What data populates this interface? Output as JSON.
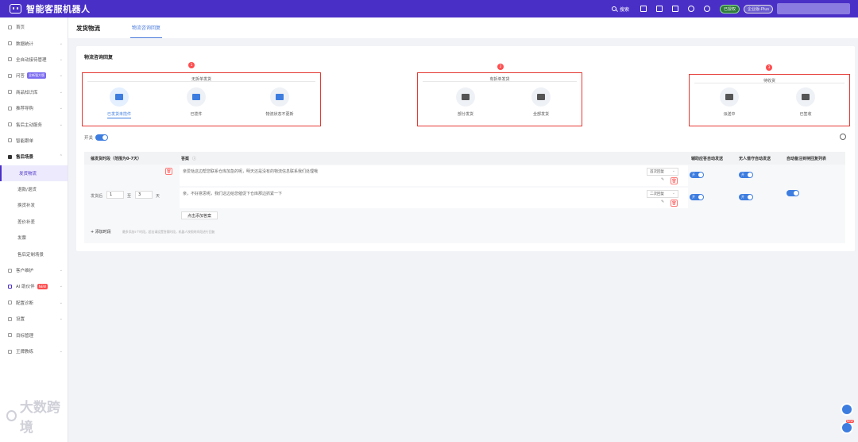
{
  "app": {
    "title": "智能客服机器人"
  },
  "topbar": {
    "search_label": "搜索",
    "badge_authorized": "已授权",
    "badge_plan": "企业版-Plus"
  },
  "sidebar": {
    "items": [
      {
        "label": "首页"
      },
      {
        "label": "数据统计"
      },
      {
        "label": "全自动接待管理"
      },
      {
        "label": "问答",
        "badge": "全新强大版"
      },
      {
        "label": "商品知识库"
      },
      {
        "label": "推荐导购"
      },
      {
        "label": "售后主动服务"
      },
      {
        "label": "智能跟单"
      },
      {
        "label": "售后场景"
      },
      {
        "label": "发货物流"
      },
      {
        "label": "退款/退货"
      },
      {
        "label": "换货补发"
      },
      {
        "label": "差价补差"
      },
      {
        "label": "发票"
      },
      {
        "label": "售后定制场景"
      },
      {
        "label": "客户维护"
      },
      {
        "label": "AI 助伙伴",
        "badge": "NEW"
      },
      {
        "label": "配置诊断"
      },
      {
        "label": "设置"
      },
      {
        "label": "目标管理"
      },
      {
        "label": "王牌教练"
      }
    ]
  },
  "watermark": "大数跨境",
  "tabs": {
    "page_title": "发货物流",
    "active_tab": "物流咨询回复"
  },
  "card": {
    "title": "物流咨询回复",
    "groups": [
      {
        "number": "1",
        "title": "无拆单发货",
        "options": [
          "已发货未揽件",
          "已揽件",
          "物流状态不更新"
        ]
      },
      {
        "number": "2",
        "title": "有拆单发货",
        "options": [
          "部分发货",
          "全部发货"
        ]
      },
      {
        "number": "3",
        "title": "待收货",
        "options": [
          "派送中",
          "已签收"
        ]
      }
    ],
    "switch_label": "开关",
    "table": {
      "headers": [
        "催发货时段（范围为0-7天）",
        "答案",
        "辅助应答自动发送",
        "无人值守自动发送",
        "自动备注到待回复列表"
      ],
      "period": {
        "prefix": "发货后",
        "from": "1",
        "to_label": "至",
        "to": "3",
        "unit": "天"
      },
      "answers": [
        {
          "text": "亲爱哒这边帮您联系仓库加急的呢，明天还是没有的物流信息联系我们处理哦",
          "select": "首次回复"
        },
        {
          "text": "亲，不好意思呢，我们这边给您催促下仓库那边抓紧一下",
          "select": "二次回复"
        }
      ],
      "toggle_on_label": "开",
      "add_answer": "点击添加答案",
      "add_period": "+ 添加时段",
      "add_period_hint": "最多添加5个时段，超出请设置答案时段，机器人按照时间段进行回复"
    }
  }
}
